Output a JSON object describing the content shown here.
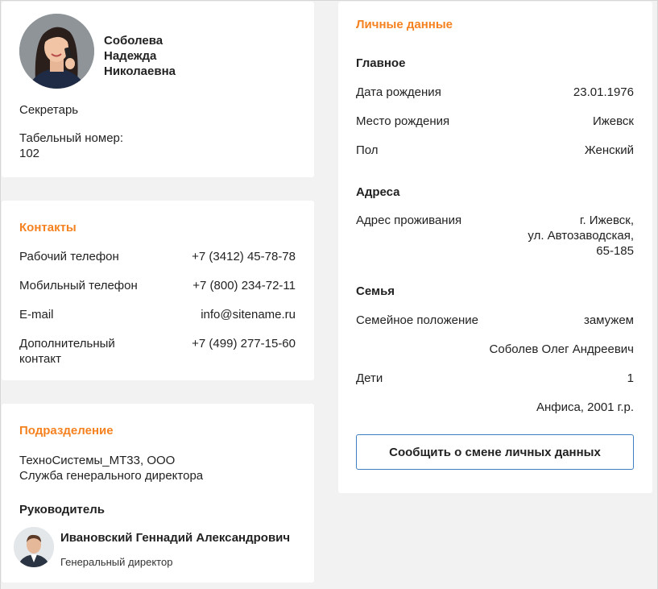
{
  "profile": {
    "surname": "Соболева",
    "first_name": "Надежда",
    "patronymic": "Николаевна",
    "position": "Секретарь",
    "tabel_label": "Табельный номер:",
    "tabel_value": "102"
  },
  "contacts": {
    "title": "Контакты",
    "work_phone_label": "Рабочий телефон",
    "work_phone_value": "+7 (3412) 45-78-78",
    "mobile_phone_label": "Мобильный телефон",
    "mobile_phone_value": "+7 (800) 234-72-11",
    "email_label": "E-mail",
    "email_value": "info@sitename.ru",
    "extra_label_line1": "Дополнительный",
    "extra_label_line2": "контакт",
    "extra_value": "+7 (499) 277-15-60"
  },
  "division": {
    "title": "Подразделение",
    "company": "ТехноСистемы_МТ33, ООО",
    "department": "Служба генерального директора",
    "head_label": "Руководитель",
    "head_name": "Ивановский Геннадий Александрович",
    "head_position": "Генеральный директор"
  },
  "personal": {
    "title": "Личные данные",
    "main_heading": "Главное",
    "birth_date_label": "Дата рождения",
    "birth_date_value": "23.01.1976",
    "birth_place_label": "Место рождения",
    "birth_place_value": "Ижевск",
    "gender_label": "Пол",
    "gender_value": "Женский",
    "address_heading": "Адреса",
    "residence_label": "Адрес проживания",
    "residence_line1": "г. Ижевск,",
    "residence_line2": "ул. Автозаводская,",
    "residence_line3": "65-185",
    "family_heading": "Семья",
    "marital_label": "Семейное положение",
    "marital_value": "замужем",
    "spouse": "Соболев Олег Андреевич",
    "children_label": "Дети",
    "children_value": "1",
    "child": "Анфиса, 2001 г.р."
  },
  "actions": {
    "report_button": "Сообщить о смене личных данных"
  },
  "colors": {
    "accent": "#f58220",
    "button_border": "#3d7fc2",
    "background": "#f2f2f2"
  }
}
